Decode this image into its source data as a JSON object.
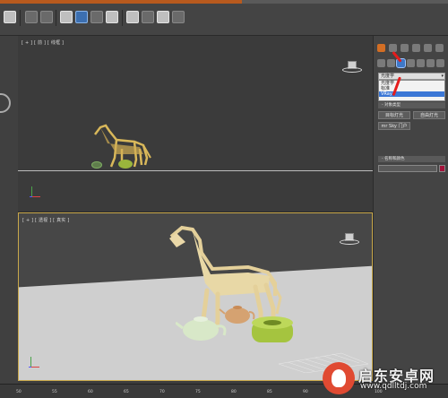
{
  "toolbar": {
    "icons": [
      "snap-toggle-icon",
      "mirror-icon",
      "align-icon",
      "layer-manager-icon",
      "scene-explorer-icon",
      "curve-editor-icon",
      "schematic-view-icon",
      "material-editor-icon",
      "render-setup-icon",
      "render-frame-icon",
      "render-icon",
      "teapot-render-icon"
    ]
  },
  "viewports": {
    "top_label": "[ + ] [ 前 ] [ 线框 ]",
    "persp_label": "[ + ] [ 透视 ] [ 真实 ]"
  },
  "command_panel": {
    "dropdown_value": "光度学",
    "dropdown_options": [
      "光度学",
      "标准",
      "VRay"
    ],
    "object_type_rollout": "- 对象类型",
    "button_target_light": "目标灯光",
    "button_free_light": "自由灯光",
    "button_sky_portal": "mr Sky 门户",
    "name_color_rollout": "- 名称和颜色",
    "name_value": "",
    "accent_colors": {
      "active_tab": "#d36e24",
      "selection": "#3b77d6",
      "object_color": "#a3123a"
    }
  },
  "timeline": {
    "ticks": [
      "50",
      "55",
      "60",
      "65",
      "70",
      "75",
      "80",
      "85",
      "90",
      "95",
      "100"
    ]
  },
  "watermark": {
    "title": "启东安卓网",
    "url": "www.qdlltdj.com"
  }
}
